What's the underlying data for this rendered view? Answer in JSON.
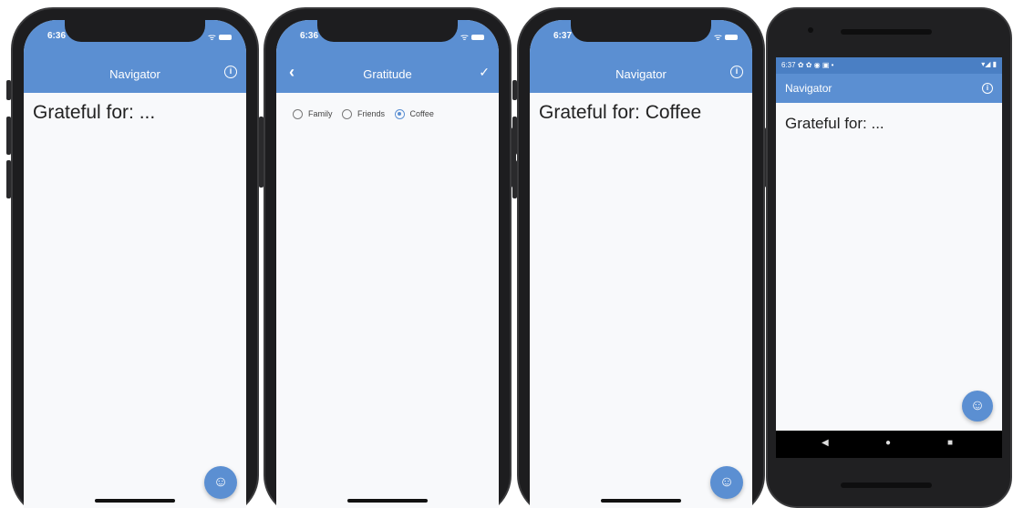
{
  "screens": [
    {
      "status_time": "6:36",
      "app_title": "Navigator",
      "info_glyph": "i",
      "body_text": "Grateful for: ...",
      "fab_glyph": "☺"
    },
    {
      "status_time": "6:36",
      "app_title": "Gratitude",
      "back_glyph": "‹",
      "check_glyph": "✓",
      "options": [
        "Family",
        "Friends",
        "Coffee"
      ],
      "selected_option": "Coffee"
    },
    {
      "status_time": "6:37",
      "app_title": "Navigator",
      "info_glyph": "i",
      "body_text": "Grateful for: Coffee",
      "fab_glyph": "☺"
    },
    {
      "status_time": "6:37",
      "status_icons_left": "✿ ✿ ◉ ▣ •",
      "status_icons_right": "▾◢ ▮",
      "app_title": "Navigator",
      "info_glyph": "i",
      "body_text": "Grateful for: ...",
      "fab_glyph": "☺",
      "nav_back": "◀",
      "nav_home": "●",
      "nav_recent": "■"
    }
  ],
  "colors": {
    "accent": "#5b8fd2",
    "android_status": "#4a7fc4",
    "background": "#f8f9fb"
  },
  "icons": [
    "info-icon",
    "back-icon",
    "check-icon",
    "emoji-fab-icon",
    "wifi-icon",
    "battery-icon"
  ]
}
